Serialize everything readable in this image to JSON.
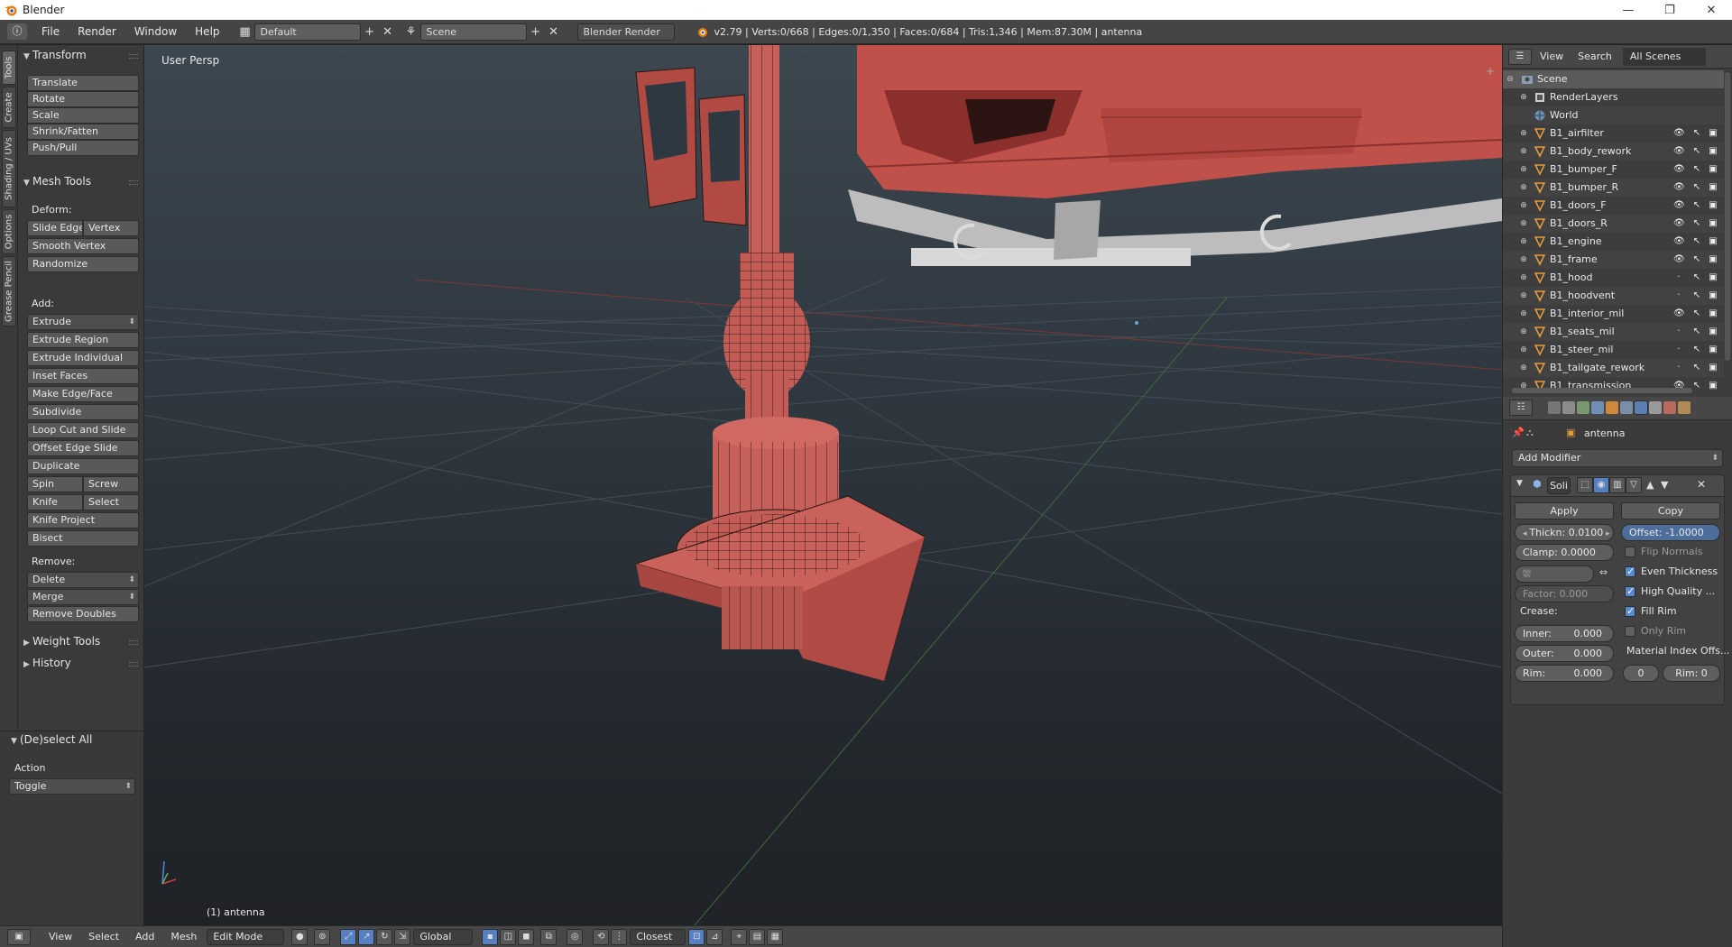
{
  "window": {
    "title": "Blender",
    "controls": [
      "—",
      "❐",
      "✕"
    ]
  },
  "info_header": {
    "menus": [
      "File",
      "Render",
      "Window",
      "Help"
    ],
    "layout": "Default",
    "scene": "Scene",
    "engine": "Blender Render",
    "stats": "v2.79 | Verts:0/668 | Edges:0/1,350 | Faces:0/684 | Tris:1,346 | Mem:87.30M | antenna"
  },
  "tool_tabs": [
    "Tools",
    "Create",
    "Shading / UVs",
    "Options",
    "Grease Pencil"
  ],
  "toolshelf": {
    "transform": {
      "title": "Transform",
      "buttons": [
        "Translate",
        "Rotate",
        "Scale",
        "Shrink/Fatten",
        "Push/Pull"
      ]
    },
    "mesh_tools": {
      "title": "Mesh Tools",
      "deform_label": "Deform:",
      "slide_edge": "Slide Edge",
      "vertex": "Vertex",
      "deform": [
        "Smooth Vertex",
        "Randomize"
      ],
      "add_label": "Add:",
      "extrude": "Extrude",
      "add": [
        "Extrude Region",
        "Extrude Individual",
        "Inset Faces",
        "Make Edge/Face",
        "Subdivide",
        "Loop Cut and Slide",
        "Offset Edge Slide",
        "Duplicate"
      ],
      "spin": "Spin",
      "screw": "Screw",
      "knife": "Knife",
      "select": "Select",
      "add2": [
        "Knife Project",
        "Bisect"
      ],
      "remove_label": "Remove:",
      "delete": "Delete",
      "merge": "Merge",
      "remove_doubles": "Remove Doubles"
    },
    "weight_tools": "Weight Tools",
    "history": "History"
  },
  "redo_panel": {
    "title": "(De)select All",
    "action_label": "Action",
    "action_value": "Toggle"
  },
  "viewport": {
    "view_label": "User Persp",
    "object_label": "(1) antenna"
  },
  "viewport_footer": {
    "menus": [
      "View",
      "Select",
      "Add",
      "Mesh"
    ],
    "mode": "Edit Mode",
    "orientation": "Global",
    "snap_target": "Closest"
  },
  "outliner": {
    "menus": [
      "View",
      "Search"
    ],
    "display": "All Scenes",
    "scene": "Scene",
    "render_layers": "RenderLayers",
    "world": "World",
    "objects": [
      {
        "name": "B1_airfilter",
        "visible": true
      },
      {
        "name": "B1_body_rework",
        "visible": true
      },
      {
        "name": "B1_bumper_F",
        "visible": true
      },
      {
        "name": "B1_bumper_R",
        "visible": true
      },
      {
        "name": "B1_doors_F",
        "visible": true
      },
      {
        "name": "B1_doors_R",
        "visible": true
      },
      {
        "name": "B1_engine",
        "visible": true
      },
      {
        "name": "B1_frame",
        "visible": true
      },
      {
        "name": "B1_hood",
        "visible": false
      },
      {
        "name": "B1_hoodvent",
        "visible": false
      },
      {
        "name": "B1_interior_mil",
        "visible": true
      },
      {
        "name": "B1_seats_mil",
        "visible": false
      },
      {
        "name": "B1_steer_mil",
        "visible": false
      },
      {
        "name": "B1_tailgate_rework",
        "visible": false
      },
      {
        "name": "B1_transmission",
        "visible": true
      }
    ]
  },
  "properties": {
    "object": "antenna",
    "add_modifier": "Add Modifier",
    "modifier": {
      "name": "Soli",
      "apply": "Apply",
      "copy": "Copy",
      "thickness": "Thickn: 0.0100",
      "offset": "Offset: -1.0000",
      "clamp": "Clamp: 0.0000",
      "factor": "Factor: 0.000",
      "crease_label": "Crease:",
      "inner_label": "Inner:",
      "inner_value": "0.000",
      "outer_label": "Outer:",
      "outer_value": "0.000",
      "rim_label": "Rim:",
      "rim_value": "0.000",
      "flip_normals": "Flip Normals",
      "even_thickness": "Even Thickness",
      "high_quality": "High Quality ...",
      "fill_rim": "Fill Rim",
      "only_rim": "Only Rim",
      "material_index": "Material Index Offs...",
      "mat_offset": "0",
      "mat_rim": "Rim: 0",
      "flags": {
        "flip_normals": false,
        "even_thickness": true,
        "high_quality": true,
        "fill_rim": true,
        "only_rim": false
      }
    }
  },
  "colors": {
    "accent": "#5680c2",
    "model": "#c8625a",
    "mesh_wire": "#2a1412",
    "header": "#474747",
    "panel": "#3b3b3b"
  }
}
